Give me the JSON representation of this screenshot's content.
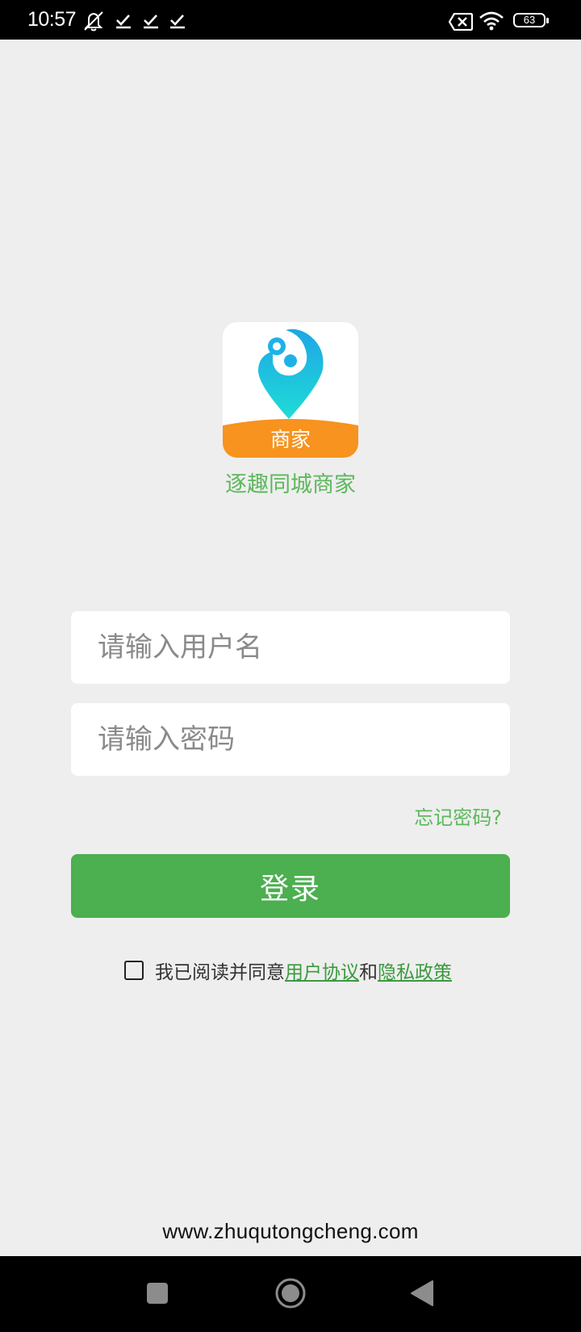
{
  "status_bar": {
    "time": "10:57",
    "icons": [
      "notifications-muted-icon",
      "check-icon",
      "check-icon",
      "check-icon",
      "sim-disabled-icon",
      "wifi-icon"
    ],
    "battery": "63"
  },
  "app": {
    "logo_badge": "商家",
    "name": "逐趣同城商家",
    "colors": {
      "accent_green": "#4caf50",
      "text_green": "#5cb85c",
      "logo_orange": "#f7931e",
      "logo_cyan": "#1ec8e0"
    }
  },
  "login": {
    "username_placeholder": "请输入用户名",
    "password_placeholder": "请输入密码",
    "forgot_password": "忘记密码?",
    "login_button": "登录"
  },
  "agreement": {
    "prefix": "我已阅读并同意",
    "user_agreement": "用户协议",
    "and": "和",
    "privacy_policy": "隐私政策"
  },
  "footer": {
    "website": "www.zhuqutongcheng.com"
  },
  "nav_bar": {
    "buttons": [
      "recents-square-icon",
      "home-circle-icon",
      "back-triangle-icon"
    ]
  }
}
